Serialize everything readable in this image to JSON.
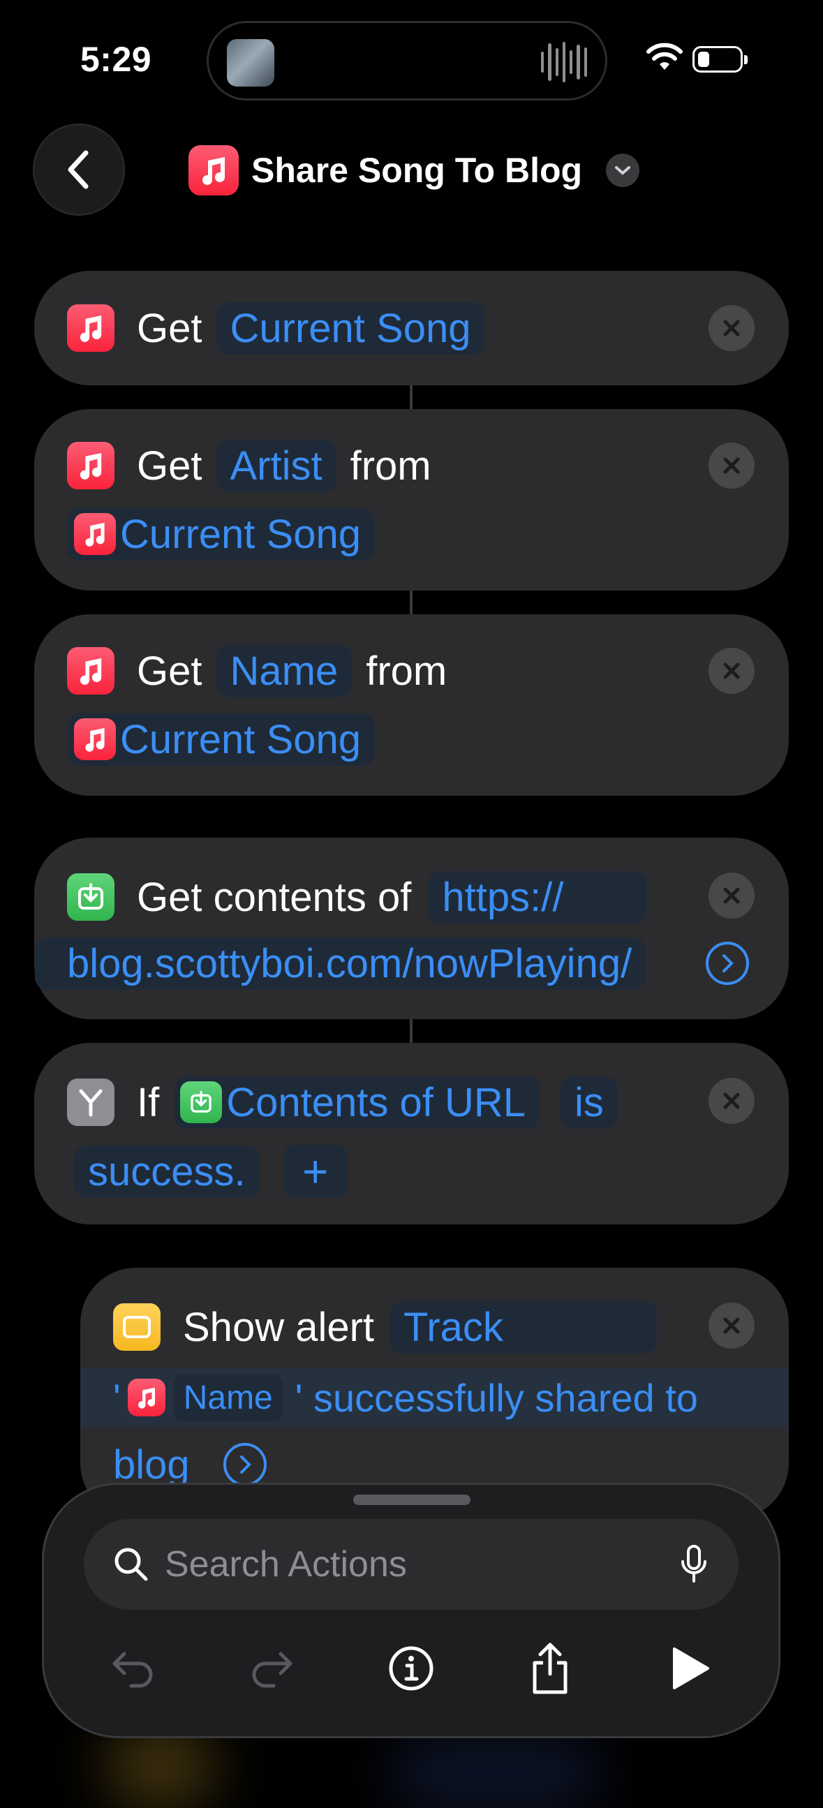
{
  "status_bar": {
    "time": "5:29"
  },
  "header": {
    "title": "Share Song To Blog"
  },
  "actions": [
    {
      "type": "get",
      "keyword": "Get",
      "token": "Current Song"
    },
    {
      "type": "get_from",
      "keyword": "Get",
      "token": "Artist",
      "from": "from",
      "source": "Current Song"
    },
    {
      "type": "get_from",
      "keyword": "Get",
      "token": "Name",
      "from": "from",
      "source": "Current Song"
    },
    {
      "type": "get_contents",
      "keyword": "Get contents of",
      "url_line1": "https://",
      "url_line2": "blog.scottyboi.com/nowPlaying/"
    },
    {
      "type": "if",
      "keyword": "If",
      "input": "Contents of URL",
      "condition": "is",
      "value": "success."
    },
    {
      "type": "show_alert",
      "keyword": "Show alert",
      "text_line1": "Track",
      "text_quote_open": "'",
      "variable": "Name",
      "text_rest": "' successfully shared to",
      "text_line3": "blog"
    }
  ],
  "search": {
    "placeholder": "Search Actions"
  },
  "toolbar": [
    "undo-icon",
    "redo-icon",
    "info-icon",
    "share-icon",
    "play-icon"
  ]
}
